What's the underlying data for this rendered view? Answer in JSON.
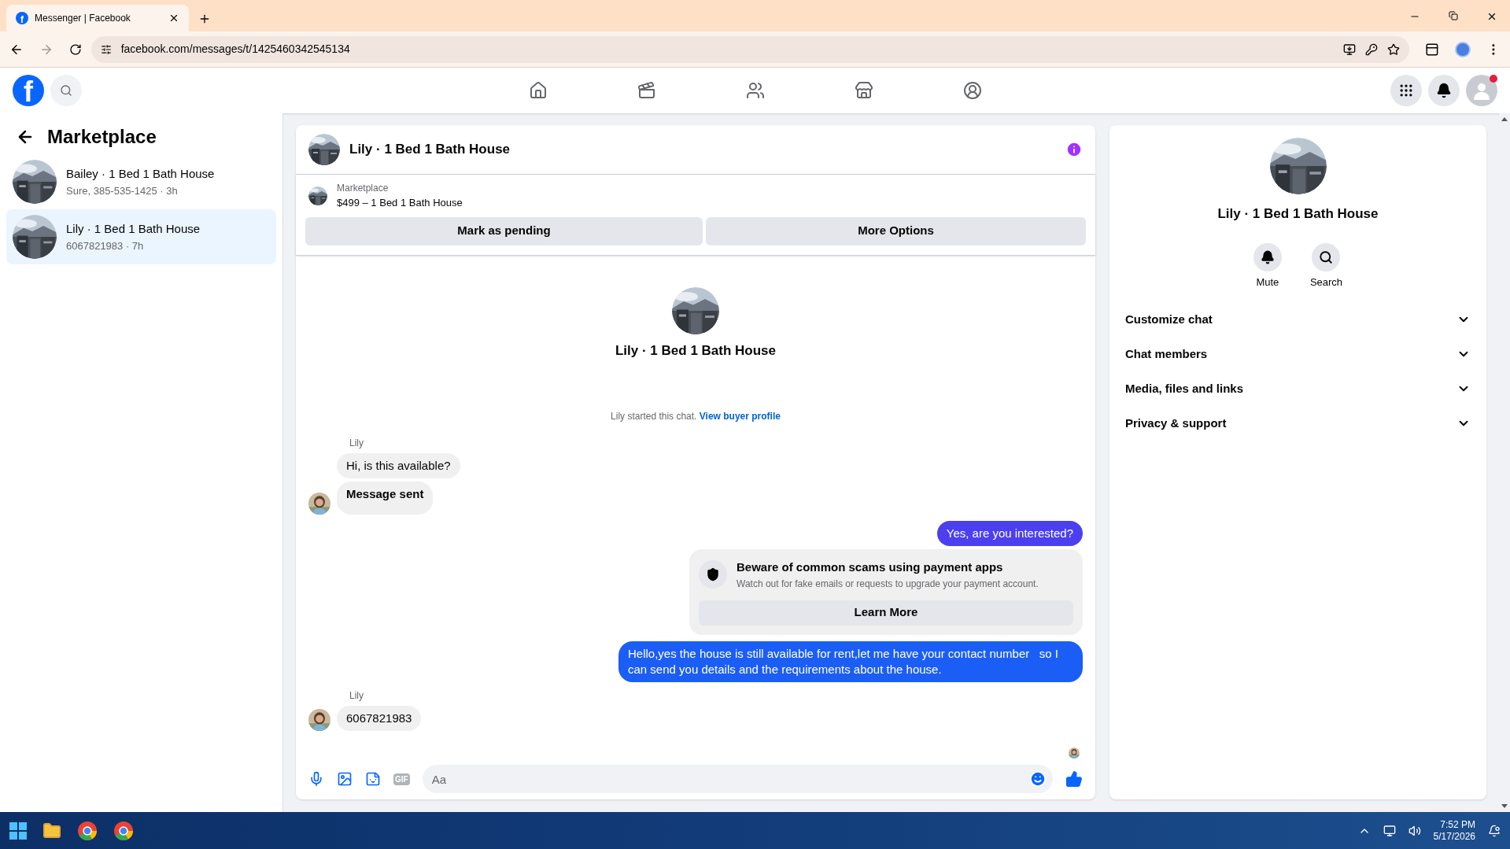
{
  "browser": {
    "favicon": "f",
    "tab_title": "Messenger | Facebook",
    "url": "facebook.com/messages/t/1425460342545134"
  },
  "nav": {
    "logo": "f"
  },
  "sidebar": {
    "title": "Marketplace",
    "conversations": [
      {
        "name": "Bailey · 1 Bed 1 Bath House",
        "preview": "Sure, 385-535-1425 · 3h",
        "selected": false
      },
      {
        "name": "Lily · 1 Bed 1 Bath House",
        "preview": "6067821983 · 7h",
        "selected": true
      }
    ]
  },
  "chat": {
    "title": "Lily · 1 Bed 1 Bath House",
    "listing": {
      "label": "Marketplace",
      "item": "$499 – 1 Bed 1 Bath House"
    },
    "actions": [
      "Mark as pending",
      "More Options"
    ],
    "intro": {
      "title": "Lily · 1 Bed 1 Bath House",
      "started": "Lily started this chat.",
      "link": "View buyer profile"
    },
    "messages": [
      {
        "kind": "incoming",
        "sender": "Lily",
        "bubbles": [
          {
            "text": "Hi, is this available?",
            "bold": false
          },
          {
            "text": "Message sent",
            "bold": true
          }
        ]
      },
      {
        "kind": "outgoing",
        "color": "#4b3ff0",
        "text": "Yes, are you interested?"
      },
      {
        "kind": "notice",
        "title": "Beware of common scams using payment apps",
        "text": "Watch out for fake emails or requests to upgrade your payment account.",
        "button": "Learn More"
      },
      {
        "kind": "outgoing",
        "color": "#1b5ef5",
        "text": "Hello,yes the house is still available for rent,let me have your contact number   so I can send you details and the requirements about the house."
      },
      {
        "kind": "incoming",
        "sender": "Lily",
        "bubbles": [
          {
            "text": "6067821983",
            "bold": false
          }
        ]
      }
    ],
    "composer": {
      "gif_label": "GIF",
      "placeholder": "Aa"
    }
  },
  "details": {
    "title": "Lily · 1 Bed 1 Bath House",
    "actions": [
      {
        "kind": "mute",
        "label": "Mute"
      },
      {
        "kind": "search",
        "label": "Search"
      }
    ],
    "sections": [
      {
        "label": "Customize chat",
        "expanded": false
      },
      {
        "label": "Chat members",
        "expanded": false
      },
      {
        "label": "Media, files and links",
        "expanded": false
      },
      {
        "label": "Privacy & support",
        "expanded": false
      }
    ]
  },
  "taskbar": {
    "time": "7:52 PM",
    "date": "5/17/2026"
  }
}
